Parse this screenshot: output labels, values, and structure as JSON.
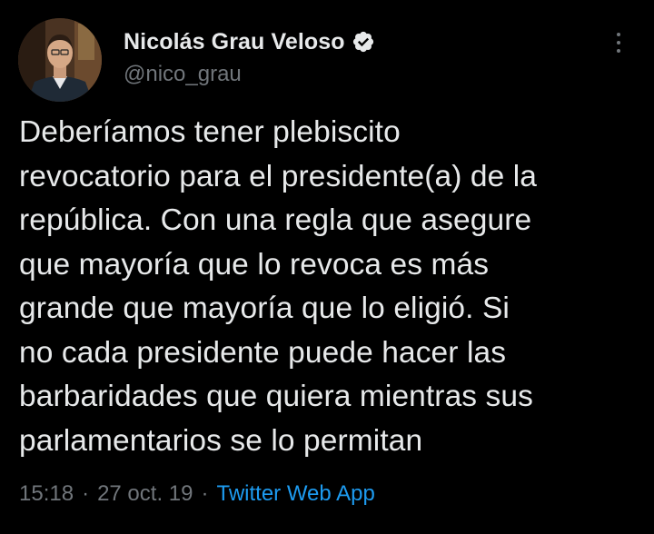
{
  "author": {
    "display_name": "Nicolás Grau Veloso",
    "handle": "@nico_grau",
    "verified_icon": "verified-badge-icon",
    "avatar_icon": "avatar-photo"
  },
  "tweet": {
    "text": "Deberíamos tener plebiscito\nrevocatorio para el presidente(a) de la\nrepública. Con una regla que asegure\nque mayoría que lo revoca es más\ngrande que mayoría que lo eligió. Si\nno cada presidente puede hacer las\nbarbaridades que quiera mientras sus\nparlamentarios se lo permitan",
    "time": "15:18",
    "separator": "·",
    "date": "27 oct. 19",
    "source": "Twitter Web App"
  },
  "colors": {
    "background": "#000000",
    "primary_text": "#e7e9ea",
    "secondary_text": "#71767b",
    "link": "#1d9bf0"
  }
}
